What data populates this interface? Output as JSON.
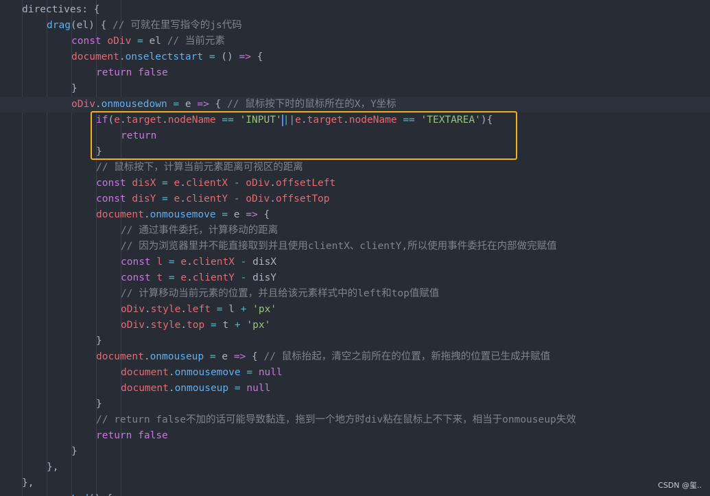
{
  "colors": {
    "background": "#282c34",
    "keyword": "#c678dd",
    "variable": "#e06c75",
    "function": "#61afef",
    "string": "#98c379",
    "comment": "#7f848e",
    "operator": "#56b6c2",
    "highlight_border": "#f2b01e"
  },
  "lines": [
    {
      "indent": 0,
      "tokens": [
        {
          "t": "directives",
          "c": "p"
        },
        {
          "t": ": {",
          "c": "p"
        }
      ]
    },
    {
      "indent": 1,
      "tokens": [
        {
          "t": "drag",
          "c": "f"
        },
        {
          "t": "(el) { ",
          "c": "p"
        },
        {
          "t": "// 可就在里写指令的js代码",
          "c": "c"
        }
      ]
    },
    {
      "indent": 2,
      "tokens": [
        {
          "t": "const",
          "c": "k"
        },
        {
          "t": " ",
          "c": "p"
        },
        {
          "t": "oDiv",
          "c": "v"
        },
        {
          "t": " ",
          "c": "p"
        },
        {
          "t": "=",
          "c": "o"
        },
        {
          "t": " el ",
          "c": "p"
        },
        {
          "t": "// 当前元素",
          "c": "c"
        }
      ]
    },
    {
      "indent": 2,
      "tokens": [
        {
          "t": "document",
          "c": "v"
        },
        {
          "t": ".",
          "c": "p"
        },
        {
          "t": "onselectstart",
          "c": "f"
        },
        {
          "t": " ",
          "c": "p"
        },
        {
          "t": "=",
          "c": "o"
        },
        {
          "t": " () ",
          "c": "p"
        },
        {
          "t": "=>",
          "c": "k"
        },
        {
          "t": " {",
          "c": "p"
        }
      ]
    },
    {
      "indent": 3,
      "tokens": [
        {
          "t": "return",
          "c": "k"
        },
        {
          "t": " ",
          "c": "p"
        },
        {
          "t": "false",
          "c": "k"
        }
      ]
    },
    {
      "indent": 2,
      "tokens": [
        {
          "t": "}",
          "c": "p"
        }
      ]
    },
    {
      "indent": 2,
      "active": true,
      "tokens": [
        {
          "t": "oDiv",
          "c": "v"
        },
        {
          "t": ".",
          "c": "p"
        },
        {
          "t": "onmousedown",
          "c": "f"
        },
        {
          "t": " ",
          "c": "p"
        },
        {
          "t": "=",
          "c": "o"
        },
        {
          "t": " e ",
          "c": "p"
        },
        {
          "t": "=>",
          "c": "k"
        },
        {
          "t": " { ",
          "c": "p"
        },
        {
          "t": "// 鼠标按下时的鼠标所在的X，Y坐标",
          "c": "c"
        }
      ]
    },
    {
      "indent": 3,
      "tokens": [
        {
          "t": "if",
          "c": "k"
        },
        {
          "t": "(",
          "c": "p"
        },
        {
          "t": "e",
          "c": "v"
        },
        {
          "t": ".",
          "c": "p"
        },
        {
          "t": "target",
          "c": "v"
        },
        {
          "t": ".",
          "c": "p"
        },
        {
          "t": "nodeName",
          "c": "v"
        },
        {
          "t": " ",
          "c": "p"
        },
        {
          "t": "==",
          "c": "o"
        },
        {
          "t": " ",
          "c": "p"
        },
        {
          "t": "'INPUT'",
          "c": "s"
        },
        {
          "t": "||",
          "c": "o",
          "caret": true
        },
        {
          "t": "e",
          "c": "v"
        },
        {
          "t": ".",
          "c": "p"
        },
        {
          "t": "target",
          "c": "v"
        },
        {
          "t": ".",
          "c": "p"
        },
        {
          "t": "nodeName",
          "c": "v"
        },
        {
          "t": " ",
          "c": "p"
        },
        {
          "t": "==",
          "c": "o"
        },
        {
          "t": " ",
          "c": "p"
        },
        {
          "t": "'TEXTAREA'",
          "c": "s"
        },
        {
          "t": "){",
          "c": "p"
        }
      ]
    },
    {
      "indent": 4,
      "tokens": [
        {
          "t": "return",
          "c": "k"
        }
      ]
    },
    {
      "indent": 3,
      "tokens": [
        {
          "t": "}",
          "c": "p"
        }
      ]
    },
    {
      "indent": 3,
      "tokens": [
        {
          "t": "// 鼠标按下，计算当前元素距离可视区的距离",
          "c": "c"
        }
      ]
    },
    {
      "indent": 3,
      "tokens": [
        {
          "t": "const",
          "c": "k"
        },
        {
          "t": " ",
          "c": "p"
        },
        {
          "t": "disX",
          "c": "v"
        },
        {
          "t": " ",
          "c": "p"
        },
        {
          "t": "=",
          "c": "o"
        },
        {
          "t": " ",
          "c": "p"
        },
        {
          "t": "e",
          "c": "v"
        },
        {
          "t": ".",
          "c": "p"
        },
        {
          "t": "clientX",
          "c": "v"
        },
        {
          "t": " ",
          "c": "p"
        },
        {
          "t": "-",
          "c": "o"
        },
        {
          "t": " ",
          "c": "p"
        },
        {
          "t": "oDiv",
          "c": "v"
        },
        {
          "t": ".",
          "c": "p"
        },
        {
          "t": "offsetLeft",
          "c": "v"
        }
      ]
    },
    {
      "indent": 3,
      "tokens": [
        {
          "t": "const",
          "c": "k"
        },
        {
          "t": " ",
          "c": "p"
        },
        {
          "t": "disY",
          "c": "v"
        },
        {
          "t": " ",
          "c": "p"
        },
        {
          "t": "=",
          "c": "o"
        },
        {
          "t": " ",
          "c": "p"
        },
        {
          "t": "e",
          "c": "v"
        },
        {
          "t": ".",
          "c": "p"
        },
        {
          "t": "clientY",
          "c": "v"
        },
        {
          "t": " ",
          "c": "p"
        },
        {
          "t": "-",
          "c": "o"
        },
        {
          "t": " ",
          "c": "p"
        },
        {
          "t": "oDiv",
          "c": "v"
        },
        {
          "t": ".",
          "c": "p"
        },
        {
          "t": "offsetTop",
          "c": "v"
        }
      ]
    },
    {
      "indent": 3,
      "tokens": [
        {
          "t": "document",
          "c": "v"
        },
        {
          "t": ".",
          "c": "p"
        },
        {
          "t": "onmousemove",
          "c": "f"
        },
        {
          "t": " ",
          "c": "p"
        },
        {
          "t": "=",
          "c": "o"
        },
        {
          "t": " e ",
          "c": "p"
        },
        {
          "t": "=>",
          "c": "k"
        },
        {
          "t": " {",
          "c": "p"
        }
      ]
    },
    {
      "indent": 4,
      "tokens": [
        {
          "t": "// 通过事件委托，计算移动的距离",
          "c": "c"
        }
      ]
    },
    {
      "indent": 4,
      "tokens": [
        {
          "t": "// 因为浏览器里并不能直接取到并且使用clientX、clientY,所以使用事件委托在内部做完赋值",
          "c": "c"
        }
      ]
    },
    {
      "indent": 4,
      "tokens": [
        {
          "t": "const",
          "c": "k"
        },
        {
          "t": " ",
          "c": "p"
        },
        {
          "t": "l",
          "c": "v"
        },
        {
          "t": " ",
          "c": "p"
        },
        {
          "t": "=",
          "c": "o"
        },
        {
          "t": " ",
          "c": "p"
        },
        {
          "t": "e",
          "c": "v"
        },
        {
          "t": ".",
          "c": "p"
        },
        {
          "t": "clientX",
          "c": "v"
        },
        {
          "t": " ",
          "c": "p"
        },
        {
          "t": "-",
          "c": "o"
        },
        {
          "t": " disX",
          "c": "p"
        }
      ]
    },
    {
      "indent": 4,
      "tokens": [
        {
          "t": "const",
          "c": "k"
        },
        {
          "t": " ",
          "c": "p"
        },
        {
          "t": "t",
          "c": "v"
        },
        {
          "t": " ",
          "c": "p"
        },
        {
          "t": "=",
          "c": "o"
        },
        {
          "t": " ",
          "c": "p"
        },
        {
          "t": "e",
          "c": "v"
        },
        {
          "t": ".",
          "c": "p"
        },
        {
          "t": "clientY",
          "c": "v"
        },
        {
          "t": " ",
          "c": "p"
        },
        {
          "t": "-",
          "c": "o"
        },
        {
          "t": " disY",
          "c": "p"
        }
      ]
    },
    {
      "indent": 4,
      "tokens": [
        {
          "t": "// 计算移动当前元素的位置，并且给该元素样式中的left和top值赋值",
          "c": "c"
        }
      ]
    },
    {
      "indent": 4,
      "tokens": [
        {
          "t": "oDiv",
          "c": "v"
        },
        {
          "t": ".",
          "c": "p"
        },
        {
          "t": "style",
          "c": "v"
        },
        {
          "t": ".",
          "c": "p"
        },
        {
          "t": "left",
          "c": "v"
        },
        {
          "t": " ",
          "c": "p"
        },
        {
          "t": "=",
          "c": "o"
        },
        {
          "t": " l ",
          "c": "p"
        },
        {
          "t": "+",
          "c": "o"
        },
        {
          "t": " ",
          "c": "p"
        },
        {
          "t": "'px'",
          "c": "s"
        }
      ]
    },
    {
      "indent": 4,
      "tokens": [
        {
          "t": "oDiv",
          "c": "v"
        },
        {
          "t": ".",
          "c": "p"
        },
        {
          "t": "style",
          "c": "v"
        },
        {
          "t": ".",
          "c": "p"
        },
        {
          "t": "top",
          "c": "v"
        },
        {
          "t": " ",
          "c": "p"
        },
        {
          "t": "=",
          "c": "o"
        },
        {
          "t": " t ",
          "c": "p"
        },
        {
          "t": "+",
          "c": "o"
        },
        {
          "t": " ",
          "c": "p"
        },
        {
          "t": "'px'",
          "c": "s"
        }
      ]
    },
    {
      "indent": 3,
      "tokens": [
        {
          "t": "}",
          "c": "p"
        }
      ]
    },
    {
      "indent": 3,
      "tokens": [
        {
          "t": "document",
          "c": "v"
        },
        {
          "t": ".",
          "c": "p"
        },
        {
          "t": "onmouseup",
          "c": "f"
        },
        {
          "t": " ",
          "c": "p"
        },
        {
          "t": "=",
          "c": "o"
        },
        {
          "t": " e ",
          "c": "p"
        },
        {
          "t": "=>",
          "c": "k"
        },
        {
          "t": " { ",
          "c": "p"
        },
        {
          "t": "// 鼠标抬起，清空之前所在的位置，新拖拽的位置已生成并赋值",
          "c": "c"
        }
      ]
    },
    {
      "indent": 4,
      "tokens": [
        {
          "t": "document",
          "c": "v"
        },
        {
          "t": ".",
          "c": "p"
        },
        {
          "t": "onmousemove",
          "c": "f"
        },
        {
          "t": " ",
          "c": "p"
        },
        {
          "t": "=",
          "c": "o"
        },
        {
          "t": " ",
          "c": "p"
        },
        {
          "t": "null",
          "c": "k"
        }
      ]
    },
    {
      "indent": 4,
      "tokens": [
        {
          "t": "document",
          "c": "v"
        },
        {
          "t": ".",
          "c": "p"
        },
        {
          "t": "onmouseup",
          "c": "f"
        },
        {
          "t": " ",
          "c": "p"
        },
        {
          "t": "=",
          "c": "o"
        },
        {
          "t": " ",
          "c": "p"
        },
        {
          "t": "null",
          "c": "k"
        }
      ]
    },
    {
      "indent": 3,
      "tokens": [
        {
          "t": "}",
          "c": "p"
        }
      ]
    },
    {
      "indent": 3,
      "tokens": [
        {
          "t": "// return false不加的话可能导致黏连，拖到一个地方时div粘在鼠标上不下来，相当于onmouseup失效",
          "c": "c"
        }
      ]
    },
    {
      "indent": 3,
      "tokens": [
        {
          "t": "return",
          "c": "k"
        },
        {
          "t": " ",
          "c": "p"
        },
        {
          "t": "false",
          "c": "k"
        }
      ]
    },
    {
      "indent": 2,
      "tokens": [
        {
          "t": "}",
          "c": "p"
        }
      ]
    },
    {
      "indent": 1,
      "tokens": [
        {
          "t": "},",
          "c": "p"
        }
      ]
    },
    {
      "indent": 0,
      "tokens": [
        {
          "t": "},",
          "c": "p"
        }
      ]
    },
    {
      "indent": 1,
      "tokens": [
        {
          "t": "mounted",
          "c": "f"
        },
        {
          "t": "() {",
          "c": "p"
        }
      ]
    }
  ],
  "watermark": "CSDN @玺.."
}
